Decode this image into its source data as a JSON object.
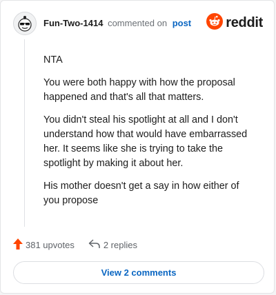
{
  "comment": {
    "username": "Fun-Two-1414",
    "action_text": "commented on",
    "post_link": "post",
    "paragraphs": [
      "NTA",
      "You were both happy with how the proposal happened and that's all that matters.",
      "You didn't steal his spotlight at all and I don't understand how that would have embarrassed her. It seems like she is trying to take the spotlight by making it about her.",
      "His mother doesn't get a say in how either of you propose"
    ]
  },
  "brand": {
    "name": "reddit",
    "color": "#ff4500"
  },
  "footer": {
    "upvotes": "381 upvotes",
    "replies": "2 replies",
    "view_comments": "View 2 comments"
  },
  "icons": {
    "avatar": "user-avatar-icon",
    "logo": "reddit-logo-icon",
    "upvote": "upvote-arrow-icon",
    "reply": "reply-arrow-icon"
  },
  "colors": {
    "accent_link": "#0a66c2",
    "upvote": "#ff4500"
  }
}
